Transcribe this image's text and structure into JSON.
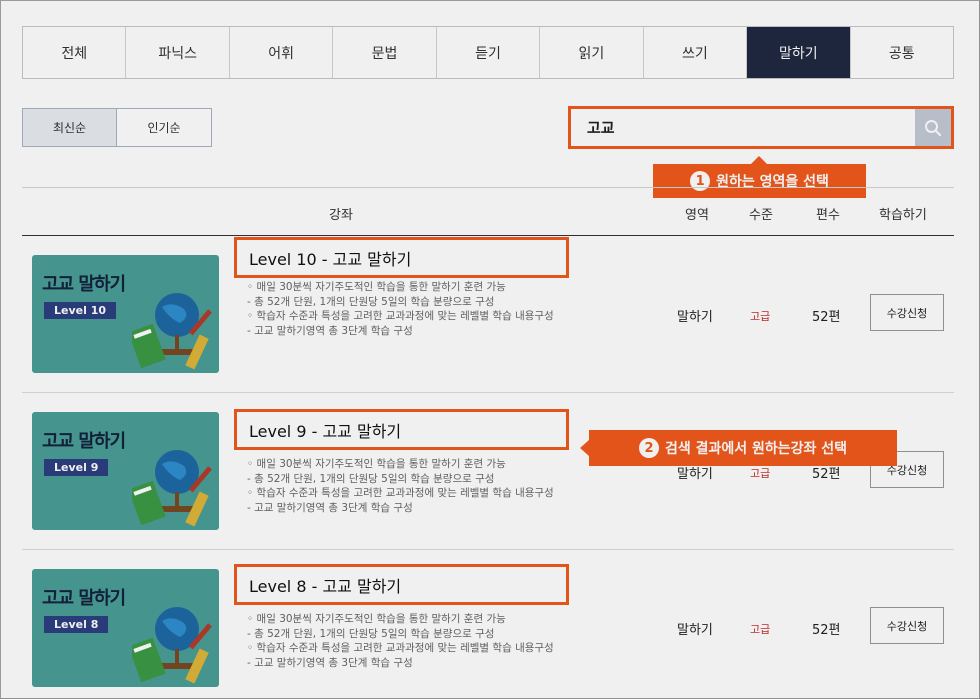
{
  "tabs": [
    {
      "label": "전체",
      "active": false
    },
    {
      "label": "파닉스",
      "active": false
    },
    {
      "label": "어휘",
      "active": false
    },
    {
      "label": "문법",
      "active": false
    },
    {
      "label": "듣기",
      "active": false
    },
    {
      "label": "읽기",
      "active": false
    },
    {
      "label": "쓰기",
      "active": false
    },
    {
      "label": "말하기",
      "active": true
    },
    {
      "label": "공통",
      "active": false
    }
  ],
  "sort": {
    "latest": "최신순",
    "popular": "인기순"
  },
  "search": {
    "value": "고교"
  },
  "callouts": {
    "step1": {
      "num": "1",
      "text": "원하는 영역을 선택"
    },
    "step2": {
      "num": "2",
      "text": "검색 결과에서 원하는강좌 선택"
    }
  },
  "table_header": {
    "course": "강좌",
    "area": "영역",
    "level": "수준",
    "count": "편수",
    "action": "학습하기"
  },
  "rows": [
    {
      "thumb_title": "고교 말하기",
      "thumb_level": "Level 10",
      "title": "Level 10 - 고교 말하기",
      "desc": [
        "◦ 매일 30분씩 자기주도적인 학습을 통한 말하기 훈련 가능",
        "- 총 52개 단원, 1개의 단원당 5일의 학습 분량으로 구성",
        "◦ 학습자 수준과 특성을 고려한 교과과정에 맞는 레벨별 학습 내용구성",
        "- 고교 말하기영역 총 3단계 학습 구성"
      ],
      "area": "말하기",
      "level": "고급",
      "count": "52편",
      "button": "수강신청"
    },
    {
      "thumb_title": "고교 말하기",
      "thumb_level": "Level 9",
      "title": "Level 9 - 고교 말하기",
      "desc": [
        "◦ 매일 30분씩 자기주도적인 학습을 통한 말하기 훈련 가능",
        "- 총 52개 단원, 1개의 단원당 5일의 학습 분량으로 구성",
        "◦ 학습자 수준과 특성을 고려한 교과과정에 맞는 레벨별 학습 내용구성",
        "- 고교 말하기영역 총 3단계 학습 구성"
      ],
      "area": "말하기",
      "level": "고급",
      "count": "52편",
      "button": "수강신청"
    },
    {
      "thumb_title": "고교 말하기",
      "thumb_level": "Level 8",
      "title": "Level 8 - 고교 말하기",
      "desc": [
        "◦ 매일 30분씩 자기주도적인 학습을 통한 말하기 훈련 가능",
        "- 총 52개 단원, 1개의 단원당 5일의 학습 분량으로 구성",
        "◦ 학습자 수준과 특성을 고려한 교과과정에 맞는 레벨별 학습 내용구성",
        "- 고교 말하기영역 총 3단계 학습 구성"
      ],
      "area": "말하기",
      "level": "고급",
      "count": "52편",
      "button": "수강신청"
    }
  ],
  "colors": {
    "accent": "#f25a1d",
    "active_tab": "#1f2940",
    "thumb_bg": "#4a9e96",
    "level_text": "#c8302b"
  }
}
